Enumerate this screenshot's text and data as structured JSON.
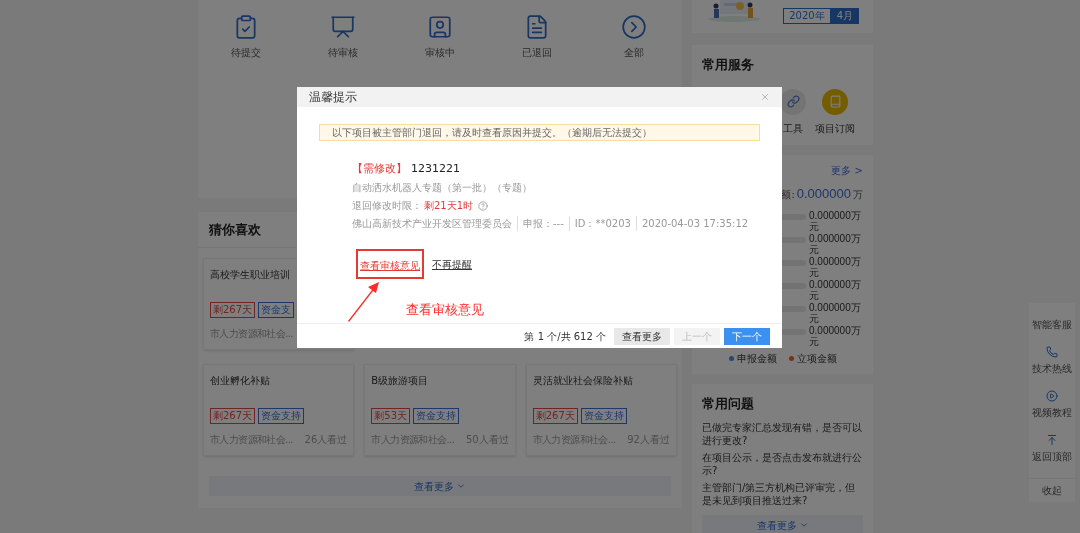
{
  "shortcuts": [
    {
      "label": "待提交"
    },
    {
      "label": "待审核"
    },
    {
      "label": "审核中"
    },
    {
      "label": "已退回"
    },
    {
      "label": "全部"
    }
  ],
  "recommend": {
    "title": "猜你喜欢",
    "cards": [
      {
        "title": "高校学生职业培训",
        "tags": [
          {
            "text": "剩267天",
            "kind": "deadline"
          },
          {
            "text": "资金支",
            "kind": "type"
          }
        ],
        "source": "市人力资源和社会..."
      },
      {
        "title": "创业孵化补贴",
        "tags": [
          {
            "text": "剩267天",
            "kind": "deadline"
          },
          {
            "text": "资金支持",
            "kind": "type"
          }
        ],
        "source": "市人力资源和社会...",
        "views": "26人看过"
      },
      {
        "title": "B级旅游项目",
        "tags": [
          {
            "text": "剩53天",
            "kind": "deadline"
          },
          {
            "text": "资金支持",
            "kind": "type"
          }
        ],
        "source": "市人力资源和社会...",
        "views": "50人看过"
      },
      {
        "title": "灵活就业社会保险补贴",
        "tags": [
          {
            "text": "剩267天",
            "kind": "deadline"
          },
          {
            "text": "资金支持",
            "kind": "type"
          }
        ],
        "source": "市人力资源和社会...",
        "views": "92人看过"
      }
    ],
    "more": "查看更多"
  },
  "date_tabs": [
    {
      "label": "2020年",
      "selected": false
    },
    {
      "label": "4月",
      "selected": true
    }
  ],
  "services": {
    "title": "常用服务",
    "items": [
      {
        "label": "工具"
      },
      {
        "label": "项目订阅"
      }
    ]
  },
  "funds": {
    "more": "更多 >",
    "amount_label": "额:",
    "amount": "0.000000",
    "amount_unit": "万",
    "bars": [
      {
        "value": "0.000000万元"
      },
      {
        "value": "0.000000万元"
      },
      {
        "value": "0.000000万元"
      },
      {
        "value": "0.000000万元"
      },
      {
        "value": "0.000000万元"
      },
      {
        "value": "0.000000万元"
      }
    ],
    "legend": [
      {
        "label": "申报金额",
        "color": "#25486f"
      },
      {
        "label": "立项金额",
        "color": "#7a3115"
      }
    ]
  },
  "faq": {
    "title": "常用问题",
    "questions": [
      "已做完专家汇总发现有错，是否可以进行更改?",
      "在项目公示，是否点击发布就进行公示?",
      "主管部门/第三方机构已评审完，但是未见到项目推送过来?"
    ],
    "more": "查看更多"
  },
  "side_tools": [
    {
      "label": "智能客服"
    },
    {
      "label": "技术热线"
    },
    {
      "label": "视频教程"
    },
    {
      "label": "返回顶部"
    },
    {
      "label": "收起"
    }
  ],
  "dialog": {
    "title": "温馨提示",
    "notice": "以下项目被主管部门退回，请及时查看原因并提交。（逾期后无法提交）",
    "item": {
      "status": "【需修改】",
      "name": "1231221",
      "subtitle": "自动洒水机器人专题（第一批）（专题）",
      "deadline_label": "退回修改时限：",
      "deadline": "剩21天1时",
      "meta": [
        "佛山高新技术产业开发区管理委员会",
        "申报：---",
        "ID：**0203",
        "2020-04-03 17:35:12"
      ]
    },
    "links": [
      {
        "label": "查看审核意见",
        "highlighted": true
      },
      {
        "label": "不再提醒",
        "highlighted": false
      }
    ],
    "annotation": "查看审核意见",
    "pager": "第 1 个/共 612 个",
    "buttons": [
      {
        "label": "查看更多",
        "kind": "secondary"
      },
      {
        "label": "上一个",
        "kind": "disabled"
      },
      {
        "label": "下一个",
        "kind": "primary"
      }
    ]
  }
}
